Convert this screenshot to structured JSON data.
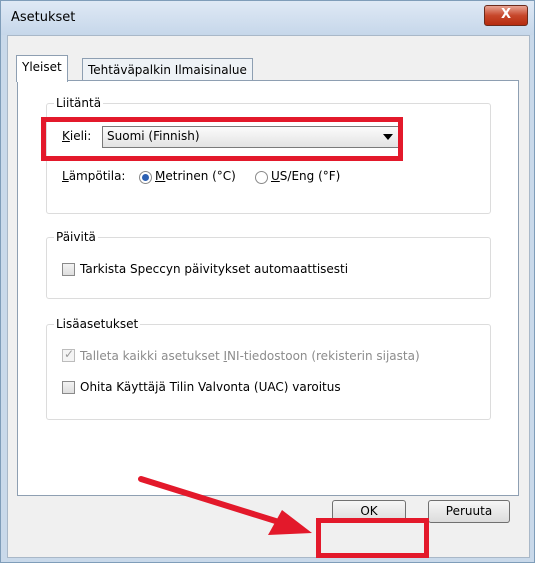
{
  "window": {
    "title": "Asetukset",
    "close_symbol": "X"
  },
  "tabs": [
    {
      "label": "Yleiset",
      "active": true
    },
    {
      "label": "Tehtäväpalkin Ilmaisinalue",
      "active": false
    }
  ],
  "groups": {
    "interface": {
      "title": "Liitäntä",
      "language_label": "Kieli:",
      "language_value": "Suomi (Finnish)",
      "temperature_label": "Lämpötila:",
      "temperature_options": [
        "Metrinen (°C)",
        "US/Eng (°F)"
      ],
      "temperature_selected": "Metrinen (°C)"
    },
    "update": {
      "title": "Päivitä",
      "auto_update_label": "Tarkista Speccyn päivitykset automaattisesti",
      "auto_update_checked": false
    },
    "advanced": {
      "title": "Lisäasetukset",
      "ini_label": "Talleta kaikki asetukset INI-tiedostoon (rekisterin sijasta)",
      "ini_checked": true,
      "ini_disabled": true,
      "uac_label": "Ohita Käyttäjä Tilin Valvonta (UAC) varoitus",
      "uac_checked": false
    }
  },
  "buttons": {
    "ok": "OK",
    "cancel": "Peruuta"
  },
  "annotation_color": "#e3192b"
}
